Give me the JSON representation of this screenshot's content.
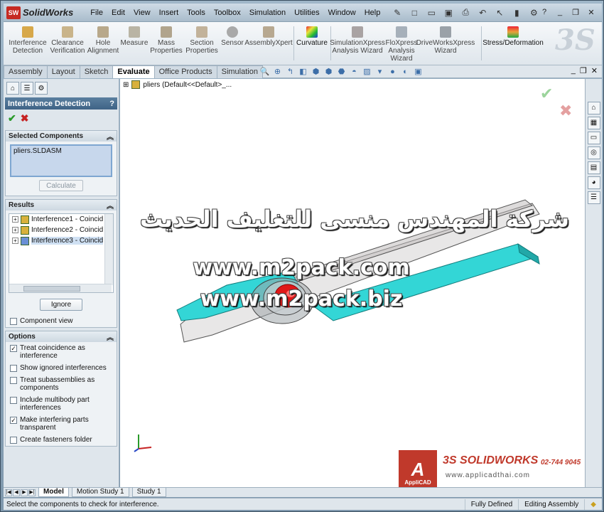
{
  "app": {
    "name": "SolidWorks",
    "badge": "SW",
    "menu": [
      "File",
      "Edit",
      "View",
      "Insert",
      "Tools",
      "Toolbox",
      "Simulation",
      "Utilities",
      "Window",
      "Help"
    ],
    "quick_access": [
      "pin-icon",
      "new-icon",
      "open-icon",
      "save-icon",
      "print-icon",
      "undo-icon",
      "select-icon",
      "rebuild-icon",
      "options-icon",
      "help-icon"
    ],
    "window_controls": [
      "minimize-icon",
      "restore-icon",
      "close-icon"
    ]
  },
  "ribbon": {
    "tools": [
      {
        "label": "Interference Detection",
        "icon": "interference-icon"
      },
      {
        "label": "Clearance Verification",
        "icon": "clearance-icon"
      },
      {
        "label": "Hole Alignment",
        "icon": "hole-icon"
      },
      {
        "label": "Measure",
        "icon": "measure-icon"
      },
      {
        "label": "Mass Properties",
        "icon": "mass-icon"
      },
      {
        "label": "Section Properties",
        "icon": "section-icon"
      },
      {
        "label": "Sensor",
        "icon": "sensor-icon"
      },
      {
        "label": "AssemblyXpert",
        "icon": "assemblyxpert-icon"
      },
      {
        "label": "Curvature",
        "icon": "curvature-icon"
      },
      {
        "label": "SimulationXpress Analysis Wizard",
        "icon": "simxpress-icon"
      },
      {
        "label": "FloXpress Analysis Wizard",
        "icon": "floxpress-icon"
      },
      {
        "label": "DriveWorksXpress Wizard",
        "icon": "driveworks-icon"
      },
      {
        "label": "Stress/Deformation",
        "icon": "stress-icon"
      }
    ],
    "logo": "3S"
  },
  "tabs": [
    {
      "label": "Assembly",
      "active": false
    },
    {
      "label": "Layout",
      "active": false
    },
    {
      "label": "Sketch",
      "active": false
    },
    {
      "label": "Evaluate",
      "active": true
    },
    {
      "label": "Office Products",
      "active": false
    },
    {
      "label": "Simulation",
      "active": false
    }
  ],
  "property_manager": {
    "title": "Interference Detection",
    "help": "?",
    "ok_glyph": "✔",
    "cancel_glyph": "✖",
    "selected_components": {
      "header": "Selected Components",
      "items": [
        "pliers.SLDASM"
      ],
      "calculate_label": "Calculate"
    },
    "results": {
      "header": "Results",
      "items": [
        "Interference1 - Coincid",
        "Interference2 - Coincid",
        "Interference3 - Coincid"
      ],
      "ignore_label": "Ignore",
      "component_view_label": "Component view",
      "component_view_checked": false
    },
    "options": {
      "header": "Options",
      "items": [
        {
          "label": "Treat coincidence as interference",
          "checked": true
        },
        {
          "label": "Show ignored interferences",
          "checked": false
        },
        {
          "label": "Treat subassemblies as components",
          "checked": false
        },
        {
          "label": "Include multibody part interferences",
          "checked": false
        },
        {
          "label": "Make interfering parts transparent",
          "checked": true
        },
        {
          "label": "Create fasteners folder",
          "checked": false
        }
      ]
    }
  },
  "graphics": {
    "tree_flyout": "pliers  (Default<<Default>_...",
    "watermark_arabic": "شركة المهندس منسى للتغليف الحديث",
    "watermark_url1": "www.m2pack.com",
    "watermark_url2": "www.m2pack.biz",
    "brand": {
      "applicad_mark": "A",
      "applicad_name": "AppliCAD",
      "solidworks": "3S SOLIDWORKS",
      "phone": "02-744 9045",
      "website": "www.applicadthai.com"
    },
    "colors": {
      "cyan": "#33d6d6",
      "gray": "#b7b2b2",
      "red": "#e01818"
    }
  },
  "task_pane_icons": [
    "home-icon",
    "design-library-icon",
    "file-explorer-icon",
    "search-icon",
    "view-palette-icon",
    "appearances-icon",
    "custom-properties-icon"
  ],
  "bottom_tabs": [
    {
      "label": "Model",
      "active": true
    },
    {
      "label": "Motion Study 1",
      "active": false
    },
    {
      "label": "Study 1",
      "active": false
    }
  ],
  "status": {
    "message": "Select the components to check for interference.",
    "definition": "Fully Defined",
    "mode": "Editing Assembly"
  }
}
